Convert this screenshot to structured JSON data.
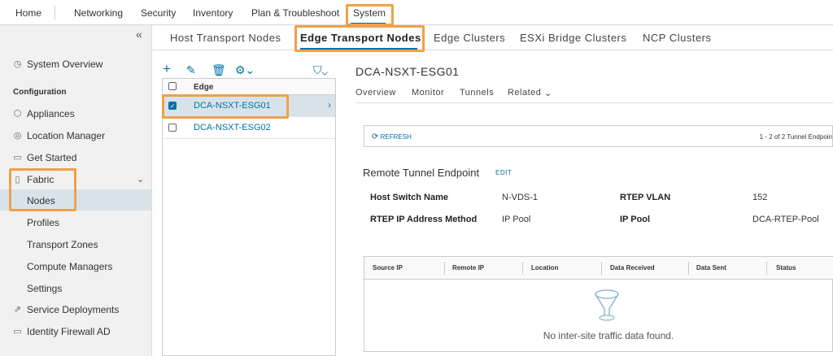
{
  "topnav": {
    "tabs": [
      "Home",
      "Networking",
      "Security",
      "Inventory",
      "Plan & Troubleshoot",
      "System"
    ],
    "active": "System"
  },
  "sidebar": {
    "collapse": "«",
    "overview": "System Overview",
    "section_config": "Configuration",
    "items": [
      "Appliances",
      "Location Manager",
      "Get Started",
      "Fabric"
    ],
    "fabric_children": [
      "Nodes",
      "Profiles",
      "Transport Zones",
      "Compute Managers",
      "Settings"
    ],
    "bottom_items": [
      "Service Deployments",
      "Identity Firewall AD"
    ]
  },
  "main_tabs": [
    "Host Transport Nodes",
    "Edge Transport Nodes",
    "Edge Clusters",
    "ESXi Bridge Clusters",
    "NCP Clusters"
  ],
  "edge_list": {
    "header": "Edge",
    "rows": [
      "DCA-NSXT-ESG01",
      "DCA-NSXT-ESG02"
    ]
  },
  "detail": {
    "title": "DCA-NSXT-ESG01",
    "subtabs": [
      "Overview",
      "Monitor",
      "Tunnels",
      "Related"
    ],
    "refresh": "REFRESH",
    "pager": "1 - 2 of 2 Tunnel Endpoin",
    "rtep_title": "Remote Tunnel Endpoint",
    "edit": "EDIT",
    "fields": {
      "host_switch_label": "Host Switch Name",
      "host_switch_value": "N-VDS-1",
      "rtep_vlan_label": "RTEP VLAN",
      "rtep_vlan_value": "152",
      "rtep_ip_method_label": "RTEP IP Address Method",
      "rtep_ip_method_value": "IP Pool",
      "ip_pool_label": "IP Pool",
      "ip_pool_value": "DCA-RTEP-Pool"
    },
    "table_columns": [
      "Source IP",
      "Remote IP",
      "Location",
      "Data Received",
      "Data Sent",
      "Status"
    ],
    "empty_text": "No inter-site traffic data found."
  },
  "colors": {
    "accent": "#0072a3",
    "highlight": "#f0a04b",
    "selected_bg": "#d8e3e9"
  }
}
